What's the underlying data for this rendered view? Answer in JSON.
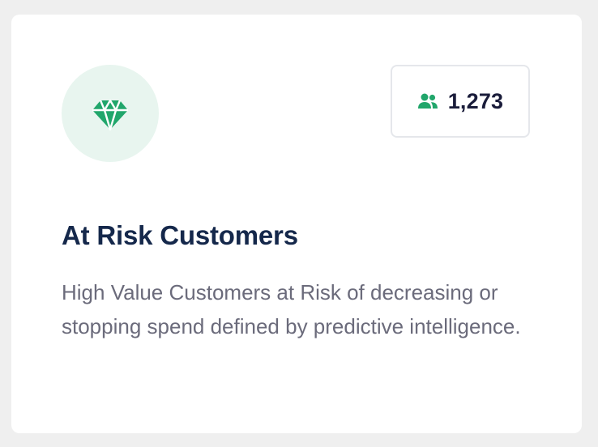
{
  "card": {
    "icon": "gem-icon",
    "count_icon": "users-icon",
    "count": "1,273",
    "title": "At Risk Customers",
    "description": "High Value Customers at Risk of decreasing or stopping spend defined by predictive intelligence."
  },
  "colors": {
    "accent": "#21a66b",
    "icon_background": "#e8f5ef",
    "title": "#15284b",
    "description": "#6b6b7b",
    "count": "#1a1c3a",
    "page_background": "#efefef",
    "card_background": "#ffffff"
  }
}
